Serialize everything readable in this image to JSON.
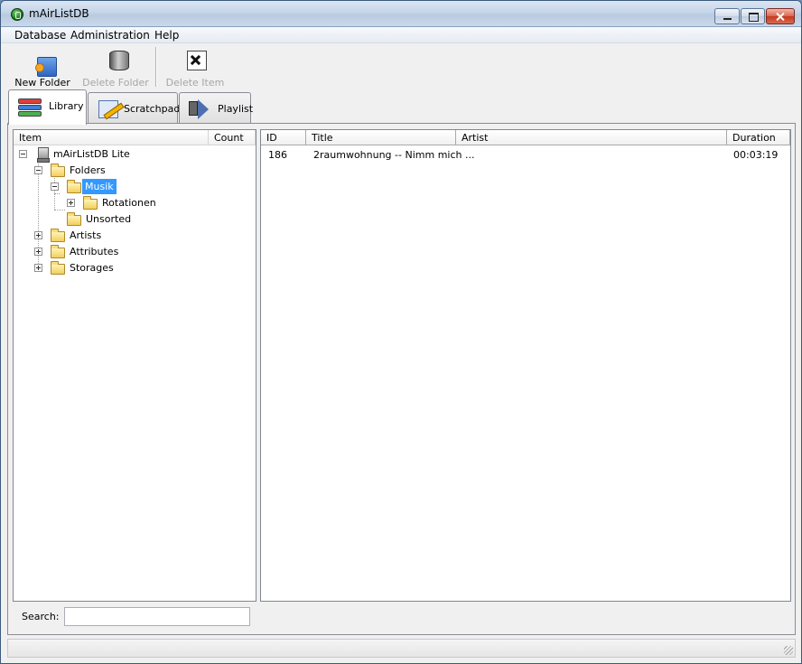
{
  "window": {
    "title": "mAirListDB"
  },
  "menu": {
    "items": [
      "Database",
      "Administration",
      "Help"
    ]
  },
  "toolbar": {
    "new_folder": "New Folder",
    "delete_folder": "Delete Folder",
    "delete_item": "Delete Item"
  },
  "tabs": [
    {
      "label": "Library",
      "icon": "books-icon",
      "active": true
    },
    {
      "label": "Scratchpad",
      "icon": "pencil-icon",
      "active": false
    },
    {
      "label": "Playlist",
      "icon": "speaker-icon",
      "active": false
    }
  ],
  "tree": {
    "columns": {
      "item": "Item",
      "count": "Count"
    },
    "nodes": {
      "root": "mAirListDB Lite",
      "folders": "Folders",
      "musik": "Musik",
      "rotationen": "Rotationen",
      "unsorted": "Unsorted",
      "artists": "Artists",
      "attributes": "Attributes",
      "storages": "Storages"
    },
    "selected": "Musik"
  },
  "list": {
    "columns": {
      "id": "ID",
      "title": "Title",
      "artist": "Artist",
      "duration": "Duration"
    },
    "rows": [
      {
        "id": "186",
        "title": "2raumwohnung -- Nimm mich ...",
        "artist": "",
        "duration": "00:03:19"
      }
    ]
  },
  "search": {
    "label": "Search:",
    "value": ""
  },
  "colors": {
    "selection": "#3399ff",
    "titlebar": "#c5d5e8"
  }
}
